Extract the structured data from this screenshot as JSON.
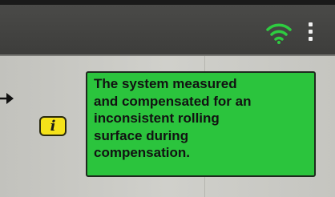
{
  "status_bar": {
    "wifi_icon": "wifi-icon",
    "menu_icon": "kebab-menu-icon",
    "wifi_color": "#2ecc40"
  },
  "notification": {
    "icon": "info-icon",
    "icon_glyph": "i",
    "icon_color": "#f5e21a",
    "message": "The system measured\nand compensated for an\ninconsistent rolling\nsurface during\ncompensation.",
    "message_background": "#2bc43d"
  }
}
